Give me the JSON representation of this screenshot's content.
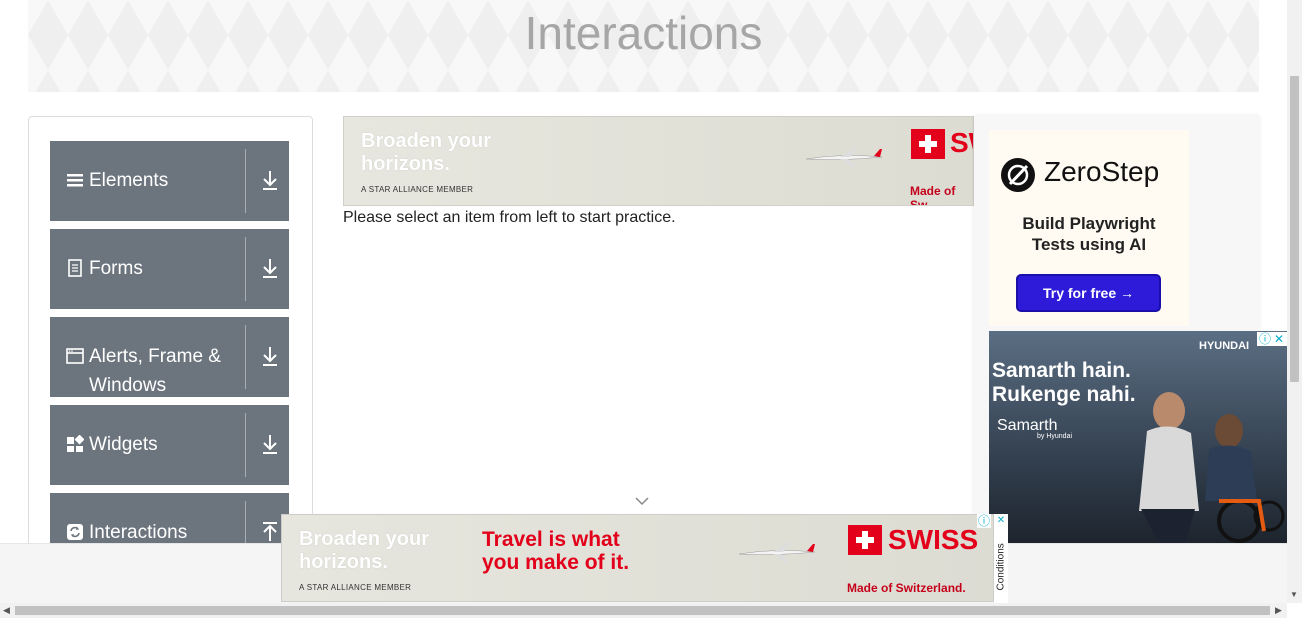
{
  "header": {
    "title": "Interactions"
  },
  "sidebar": {
    "groups": [
      {
        "label": "Elements",
        "icon": "hamburger-icon",
        "arrow": "download-arrow-icon"
      },
      {
        "label": "Forms",
        "icon": "document-icon",
        "arrow": "download-arrow-icon"
      },
      {
        "label": "Alerts, Frame & Windows",
        "icon": "window-icon",
        "arrow": "download-arrow-icon"
      },
      {
        "label": "Widgets",
        "icon": "widgets-icon",
        "arrow": "download-arrow-icon"
      },
      {
        "label": "Interactions",
        "icon": "refresh-icon",
        "arrow": "upload-arrow-icon"
      }
    ]
  },
  "main": {
    "message": "Please select an item from left to start practice."
  },
  "ads": {
    "top_banner": {
      "line1": "Broaden your",
      "line2": "horizons.",
      "member": "A STAR ALLIANCE MEMBER",
      "brand": "SW",
      "tagline": "Made of Sw"
    },
    "zerostep": {
      "name": "ZeroStep",
      "tagline_line1": "Build Playwright",
      "tagline_line2": "Tests using AI",
      "button": "Try for free →"
    },
    "hyundai": {
      "headline_line1": "Samarth hain.",
      "headline_line2": "Rukenge nahi.",
      "brand": "HYUNDAI",
      "product": "Samarth",
      "product_sub": "by Hyundai"
    },
    "bottom_banner": {
      "line1": "Broaden your",
      "line2": "horizons.",
      "travel_line1": "Travel is what",
      "travel_line2": "you make of it.",
      "member": "A STAR ALLIANCE MEMBER",
      "brand": "SWISS",
      "tagline": "Made of Switzerland.",
      "conditions": "Conditions"
    }
  },
  "colors": {
    "group_bg": "#6c757d",
    "swiss_red": "#e2001a",
    "zerostep_button": "#2d1bd9"
  }
}
